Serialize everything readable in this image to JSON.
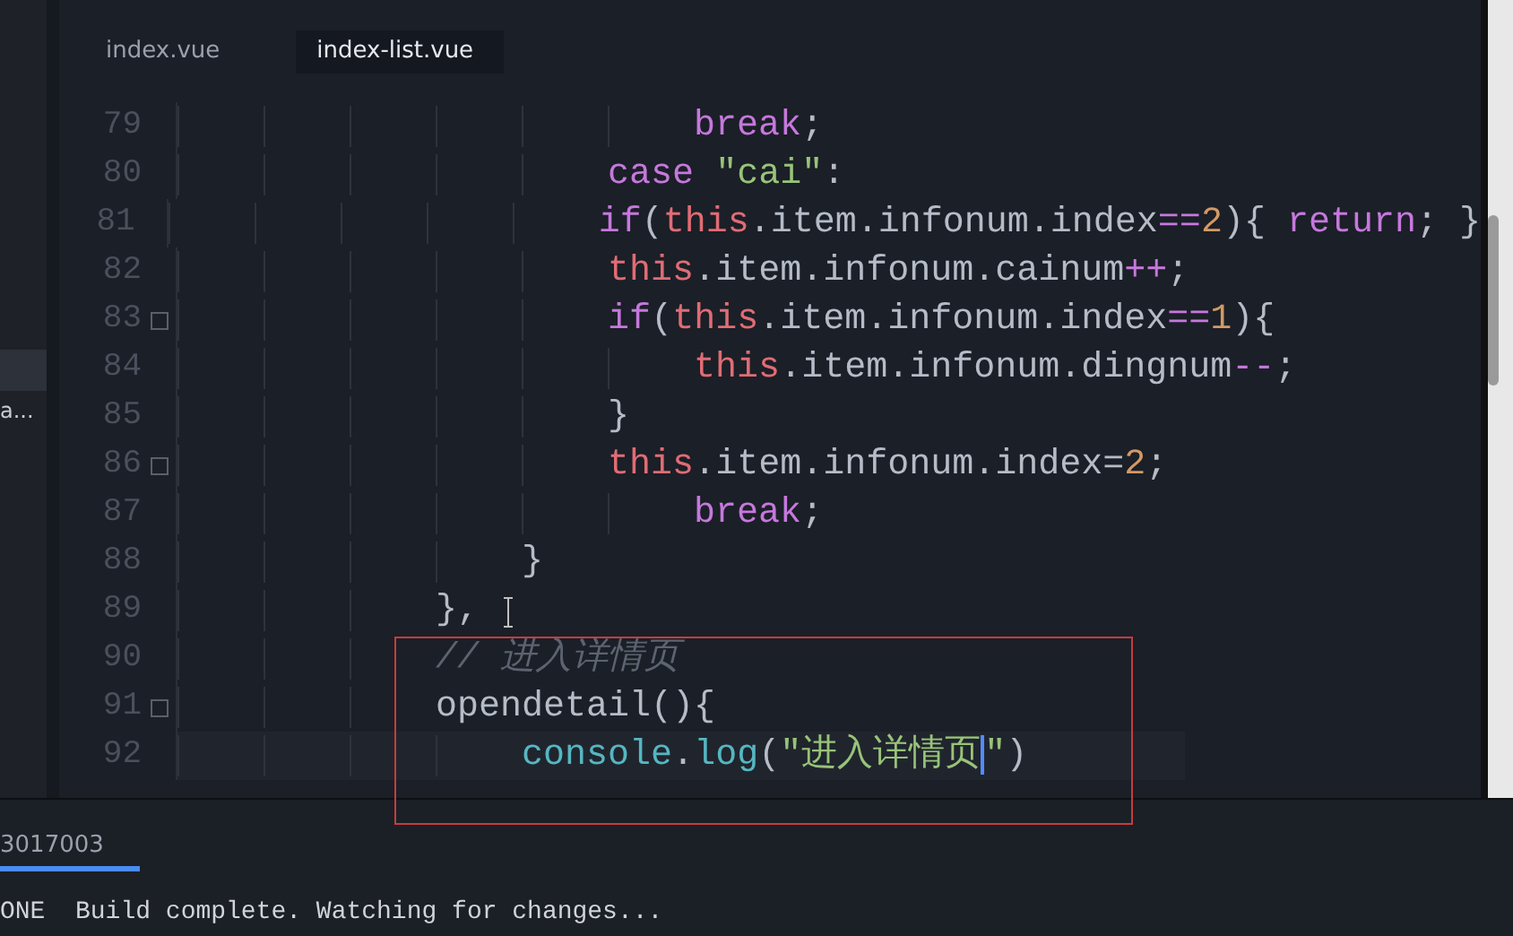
{
  "sidebar": {
    "items": [
      {
        "selected": true
      },
      {
        "label": "a...",
        "selected": false
      }
    ]
  },
  "editor": {
    "tabs": [
      {
        "label": "index.vue",
        "selected": false
      },
      {
        "label": "index-list.vue",
        "selected": true
      }
    ],
    "lines": [
      {
        "number": "79",
        "fold": false,
        "current": false,
        "tokens": [
          {
            "kind": "kw",
            "text": "                        break"
          },
          {
            "kind": "plain",
            "text": ";"
          }
        ]
      },
      {
        "number": "80",
        "fold": false,
        "current": false,
        "tokens": [
          {
            "kind": "kw",
            "text": "                    case"
          },
          {
            "kind": "str",
            "text": " \"cai\""
          },
          {
            "kind": "plain",
            "text": ":"
          }
        ]
      },
      {
        "number": "81",
        "fold": false,
        "current": false,
        "tokens": [
          {
            "kind": "kw",
            "text": "                    if"
          },
          {
            "kind": "plain",
            "text": "("
          },
          {
            "kind": "this",
            "text": "this"
          },
          {
            "kind": "plain",
            "text": ".item.infonum.index"
          },
          {
            "kind": "op",
            "text": "=="
          },
          {
            "kind": "num",
            "text": "2"
          },
          {
            "kind": "plain",
            "text": "){"
          },
          {
            "kind": "kw",
            "text": " return"
          },
          {
            "kind": "plain",
            "text": "; }"
          }
        ]
      },
      {
        "number": "82",
        "fold": false,
        "current": false,
        "tokens": [
          {
            "kind": "this",
            "text": "                    this"
          },
          {
            "kind": "plain",
            "text": ".item.infonum.cainum"
          },
          {
            "kind": "op",
            "text": "++"
          },
          {
            "kind": "plain",
            "text": ";"
          }
        ]
      },
      {
        "number": "83",
        "fold": true,
        "current": false,
        "tokens": [
          {
            "kind": "kw",
            "text": "                    if"
          },
          {
            "kind": "plain",
            "text": "("
          },
          {
            "kind": "this",
            "text": "this"
          },
          {
            "kind": "plain",
            "text": ".item.infonum.index"
          },
          {
            "kind": "op",
            "text": "=="
          },
          {
            "kind": "num",
            "text": "1"
          },
          {
            "kind": "plain",
            "text": "){"
          }
        ]
      },
      {
        "number": "84",
        "fold": false,
        "current": false,
        "tokens": [
          {
            "kind": "this",
            "text": "                        this"
          },
          {
            "kind": "plain",
            "text": ".item.infonum.dingnum"
          },
          {
            "kind": "op",
            "text": "--"
          },
          {
            "kind": "plain",
            "text": ";"
          }
        ]
      },
      {
        "number": "85",
        "fold": false,
        "current": false,
        "tokens": [
          {
            "kind": "plain",
            "text": "                    }"
          }
        ]
      },
      {
        "number": "86",
        "fold": true,
        "current": false,
        "tokens": [
          {
            "kind": "this",
            "text": "                    this"
          },
          {
            "kind": "plain",
            "text": ".item.infonum.index="
          },
          {
            "kind": "num",
            "text": "2"
          },
          {
            "kind": "plain",
            "text": ";"
          }
        ]
      },
      {
        "number": "87",
        "fold": false,
        "current": false,
        "tokens": [
          {
            "kind": "kw",
            "text": "                        break"
          },
          {
            "kind": "plain",
            "text": ";"
          }
        ]
      },
      {
        "number": "88",
        "fold": false,
        "current": false,
        "tokens": [
          {
            "kind": "plain",
            "text": "                }"
          }
        ]
      },
      {
        "number": "89",
        "fold": false,
        "current": false,
        "tokens": [
          {
            "kind": "plain",
            "text": "            },"
          }
        ]
      },
      {
        "number": "90",
        "fold": false,
        "current": false,
        "tokens": [
          {
            "kind": "cmt",
            "text": "            // 进入详情页"
          }
        ]
      },
      {
        "number": "91",
        "fold": true,
        "current": false,
        "tokens": [
          {
            "kind": "plain",
            "text": "            opendetail(){"
          }
        ]
      },
      {
        "number": "92",
        "fold": false,
        "current": true,
        "tokens": [
          {
            "kind": "fn",
            "text": "                console"
          },
          {
            "kind": "plain",
            "text": "."
          },
          {
            "kind": "fn",
            "text": "log"
          },
          {
            "kind": "plain",
            "text": "("
          },
          {
            "kind": "str",
            "text": "\"进入详情页"
          },
          {
            "kind": "caret"
          },
          {
            "kind": "str",
            "text": "\""
          },
          {
            "kind": "plain",
            "text": ")"
          }
        ]
      }
    ]
  },
  "panel": {
    "tabs": [
      {
        "label": "3017003",
        "selected": true
      }
    ],
    "output": "ONE  Build complete. Watching for changes..."
  }
}
